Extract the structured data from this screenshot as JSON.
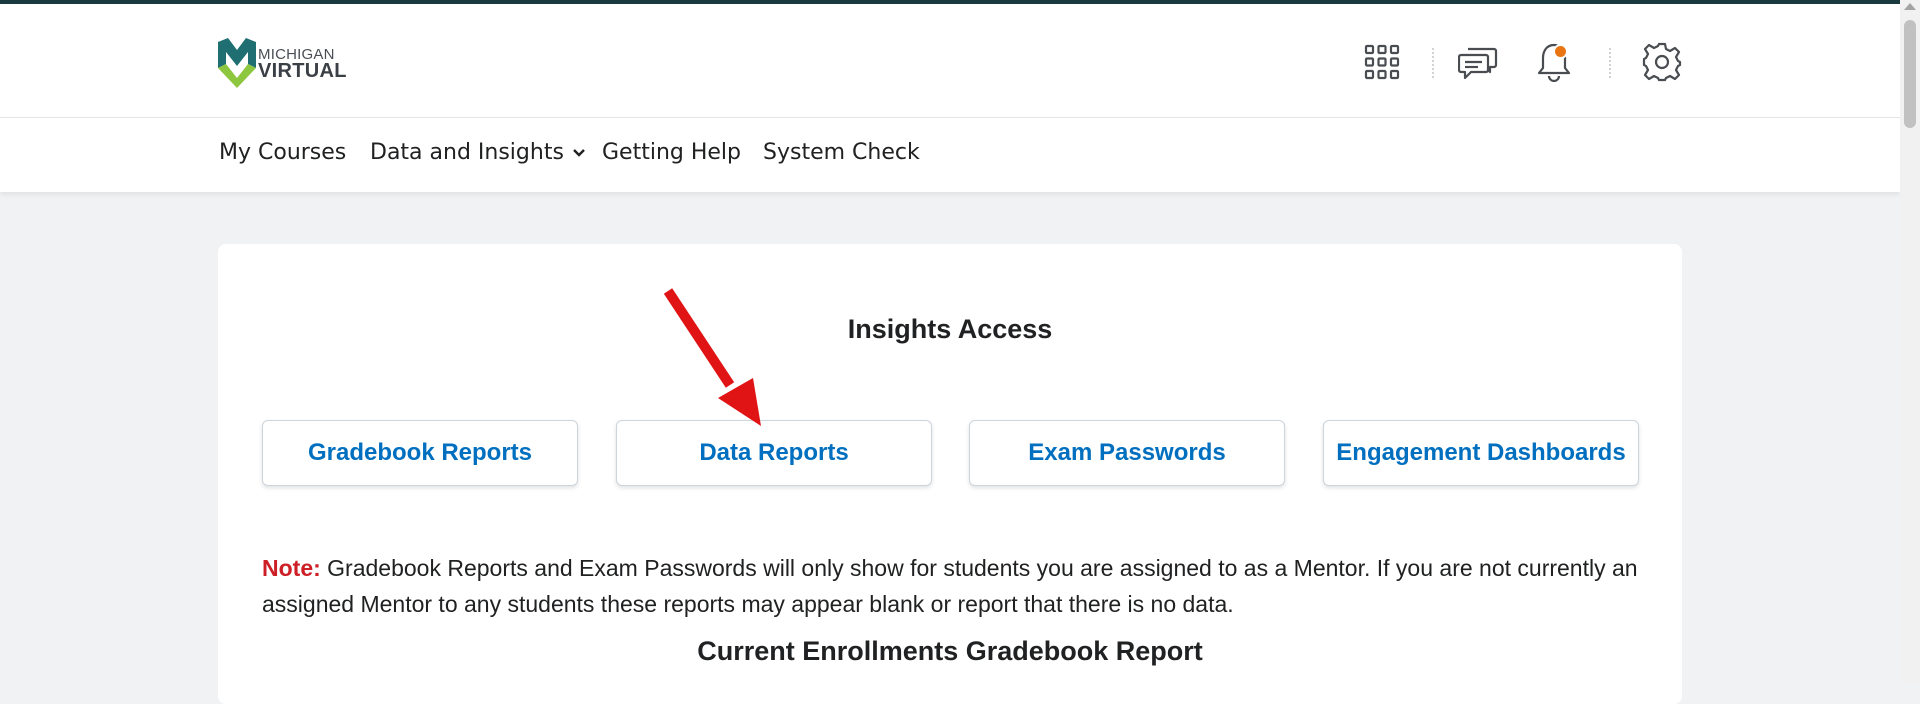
{
  "logo": {
    "line1": "MICHIGAN",
    "line2": "VIRTUAL"
  },
  "header_icons": [
    "apps-grid-icon",
    "message-icon",
    "bell-icon",
    "gear-icon"
  ],
  "nav": {
    "items": [
      {
        "label": "My Courses"
      },
      {
        "label": "Data and Insights"
      },
      {
        "label": "Getting Help"
      },
      {
        "label": "System Check"
      }
    ]
  },
  "card": {
    "title": "Insights Access",
    "buttons": [
      {
        "label": "Gradebook Reports"
      },
      {
        "label": "Data Reports"
      },
      {
        "label": "Exam Passwords"
      },
      {
        "label": "Engagement Dashboards"
      }
    ],
    "note_label": "Note:",
    "note_text": " Gradebook Reports and Exam Passwords will only show for students you are assigned to as a Mentor. If you are not currently an assigned Mentor to any students these reports may appear blank or report that there is no data.",
    "subtitle": "Current Enrollments Gradebook Report"
  },
  "colors": {
    "accent_link": "#006fbf",
    "note_red": "#cd2026",
    "notification_dot": "#e87511",
    "annotation_arrow": "#e01414",
    "top_line": "#1b3a3f"
  }
}
